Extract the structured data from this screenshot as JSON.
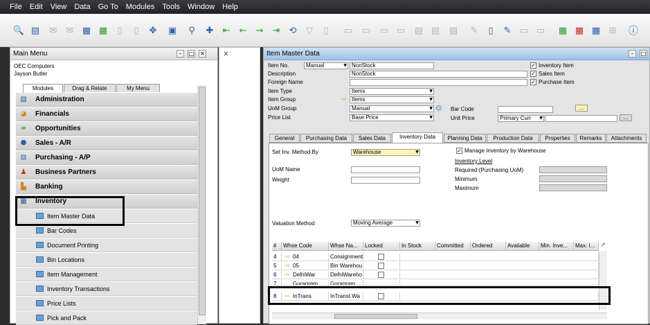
{
  "menubar": [
    "File",
    "Edit",
    "View",
    "Data",
    "Go To",
    "Modules",
    "Tools",
    "Window",
    "Help"
  ],
  "left_panel": {
    "title": "Main Menu",
    "company": "OEC Computers",
    "user": "Jayson Butler",
    "tabs": [
      "Modules",
      "Drag & Relate",
      "My Menu"
    ],
    "modules": [
      {
        "label": "Administration",
        "icon": "administration-icon"
      },
      {
        "label": "Financials",
        "icon": "financials-icon"
      },
      {
        "label": "Opportunities",
        "icon": "opportunities-icon"
      },
      {
        "label": "Sales - A/R",
        "icon": "sales-icon"
      },
      {
        "label": "Purchasing - A/P",
        "icon": "purchasing-icon"
      },
      {
        "label": "Business Partners",
        "icon": "business-partners-icon"
      },
      {
        "label": "Banking",
        "icon": "banking-icon"
      },
      {
        "label": "Inventory",
        "icon": "inventory-icon"
      }
    ],
    "inventory_items": [
      "Item Master Data",
      "Bar Codes",
      "Document Printing",
      "Bin Locations",
      "Item Management",
      "Inventory Transactions",
      "Price Lists",
      "Pick and Pack"
    ]
  },
  "item_master": {
    "title": "Item Master Data",
    "labels": {
      "item_no": "Item No.",
      "description": "Description",
      "foreign_name": "Foreign Name",
      "item_type": "Item Type",
      "item_group": "Item Group",
      "uom_group": "UoM Group",
      "price_list": "Price List",
      "bar_code": "Bar Code",
      "unit_price": "Unit Price"
    },
    "values": {
      "series": "Manual",
      "item_no": "NonStock",
      "description": "NonStock",
      "item_type": "Items",
      "item_group": "Items",
      "uom_group": "Manual",
      "price_list": "Base Price",
      "unit_price_currency": "Primary Curr",
      "bar_code_btn": "...",
      "unit_price_btn": "..."
    },
    "checkboxes": [
      {
        "label": "Inventory Item",
        "checked": true
      },
      {
        "label": "Sales Item",
        "checked": true
      },
      {
        "label": "Purchase Item",
        "checked": true
      }
    ],
    "tabs": [
      "General",
      "Purchasing Data",
      "Sales Data",
      "Inventory Data",
      "Planning Data",
      "Production Data",
      "Properties",
      "Remarks",
      "Attachments"
    ],
    "active_tab": "Inventory Data",
    "inventory": {
      "set_inv_method_label": "Set Inv. Method By",
      "set_inv_method_value": "Warehouse",
      "manage_by_wh_label": "Manage Inventory by Warehouse",
      "uom_name_label": "UoM Name",
      "weight_label": "Weight",
      "inventory_level_label": "Inventory Level",
      "required_label": "Required (Purchasing UoM)",
      "minimum_label": "Minimum",
      "maximum_label": "Maximum",
      "valuation_method_label": "Valuation Method",
      "valuation_method_value": "Moving Average"
    },
    "grid": {
      "columns": [
        "#",
        "Whse Code",
        "Whse Na...",
        "Locked",
        "In Stock",
        "Committed",
        "Ordered",
        "Available",
        "Min. Inve...",
        "Max. I..."
      ],
      "rows": [
        {
          "num": "4",
          "code": "04",
          "name": "Consignment"
        },
        {
          "num": "5",
          "code": "05",
          "name": "Bin Warehou"
        },
        {
          "num": "6",
          "code": "DelhiWar",
          "name": "DelhiWareho"
        },
        {
          "num": "7",
          "code": "Guragram",
          "name": "Guragram"
        },
        {
          "num": "8",
          "code": "InTrans",
          "name": "InTranst Wa"
        }
      ]
    }
  }
}
